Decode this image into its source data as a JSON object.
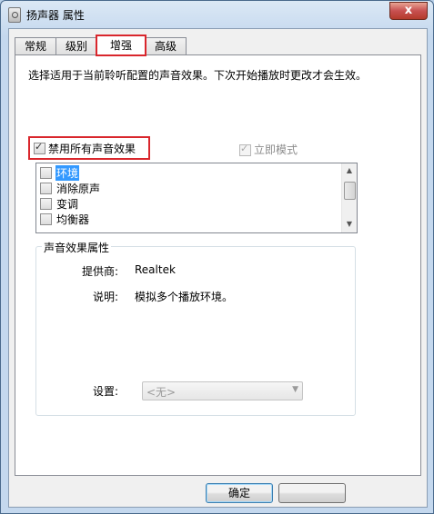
{
  "window": {
    "title": "扬声器 属性",
    "close_glyph": "x"
  },
  "tabs": [
    {
      "label": "常规"
    },
    {
      "label": "级别"
    },
    {
      "label": "增强"
    },
    {
      "label": "高级"
    }
  ],
  "enhancement": {
    "description": "选择适用于当前聆听配置的声音效果。下次开始播放时更改才会生效。",
    "disable_all_label": "禁用所有声音效果",
    "disable_all_checked": true,
    "immediate_mode_label": "立即模式",
    "immediate_mode_checked": true,
    "effects": [
      {
        "label": "环境",
        "selected": true
      },
      {
        "label": "消除原声",
        "selected": false
      },
      {
        "label": "变调",
        "selected": false
      },
      {
        "label": "均衡器",
        "selected": false
      }
    ]
  },
  "properties": {
    "group_title": "声音效果属性",
    "provider_label": "提供商:",
    "provider_value": "Realtek",
    "desc_label": "说明:",
    "desc_value": "模拟多个播放环境。",
    "settings_label": "设置:",
    "settings_value": "<无>"
  },
  "buttons": {
    "ok": "确定"
  },
  "colors": {
    "highlight_outline": "#d9262c",
    "selection": "#3399ff"
  }
}
